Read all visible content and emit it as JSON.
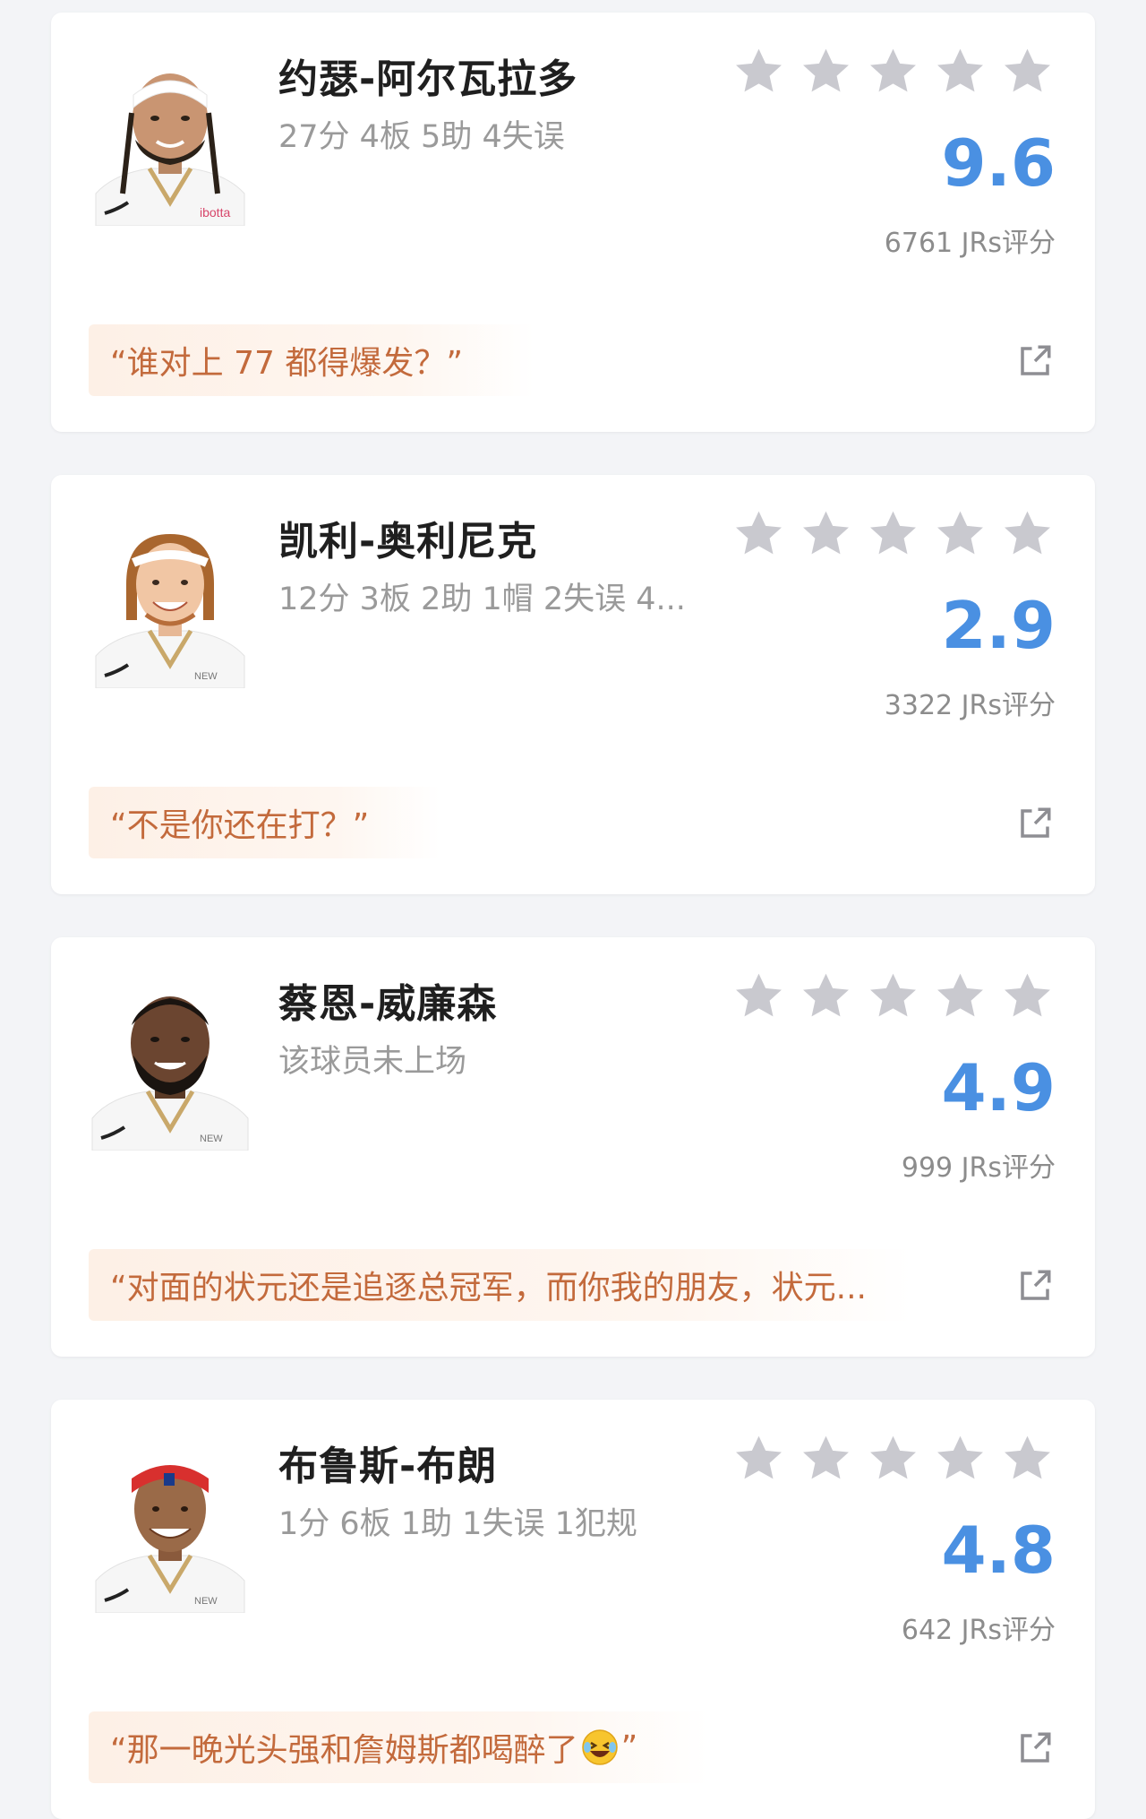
{
  "colors": {
    "accent_score": "#4a90e2",
    "comment_text": "#c36a3c",
    "comment_bg": "#fdf0e6",
    "star_empty": "#c9c9cf",
    "page_bg": "#f3f4f7"
  },
  "icons": {
    "star": "star-icon",
    "share": "share-external-icon",
    "emoji": "laughing-crying-emoji"
  },
  "cards": [
    {
      "name": "约瑟-阿尔瓦拉多",
      "stats": "27分 4板 5助 4失误",
      "rating_stars_filled": 0,
      "score": "9.6",
      "votes": "6761 JRs评分",
      "comment": "“谁对上 77 都得爆发？”",
      "jersey_color": "#ffffff",
      "accent": "#c9a86a",
      "headband": "white"
    },
    {
      "name": "凯利-奥利尼克",
      "stats": "12分 3板 2助 1帽 2失误 4...",
      "rating_stars_filled": 0,
      "score": "2.9",
      "votes": "3322 JRs评分",
      "comment": "“不是你还在打？”",
      "jersey_color": "#ffffff",
      "accent": "#c9a86a",
      "headband": "white"
    },
    {
      "name": "蔡恩-威廉森",
      "stats": "该球员未上场",
      "rating_stars_filled": 0,
      "score": "4.9",
      "votes": "999 JRs评分",
      "comment": "“对面的状元还是追逐总冠军，而你我的朋友，状元...",
      "jersey_color": "#ffffff",
      "accent": "#c9a86a",
      "headband": "none"
    },
    {
      "name": "布鲁斯-布朗",
      "stats": "1分 6板 1助 1失误 1犯规",
      "rating_stars_filled": 0,
      "score": "4.8",
      "votes": "642 JRs评分",
      "comment": "“那一晚光头强和詹姆斯都喝醉了",
      "comment_suffix": "”",
      "has_emoji": true,
      "jersey_color": "#ffffff",
      "accent": "#c9a86a",
      "headband": "red"
    }
  ]
}
